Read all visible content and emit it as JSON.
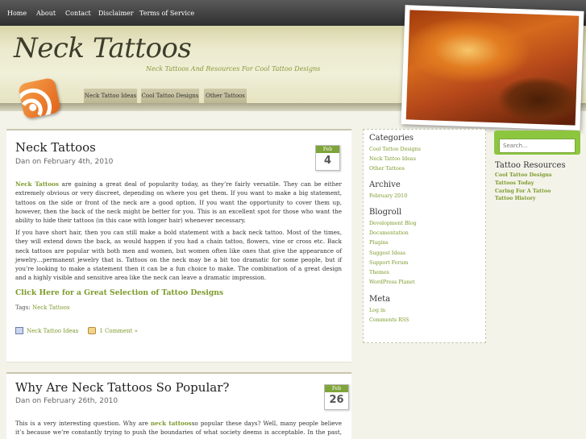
{
  "nav": [
    "Home",
    "About",
    "Contact",
    "Disclaimer",
    "Terms of Service"
  ],
  "site": {
    "title": "Neck Tattoos",
    "tagline": "Neck Tattoos And Resources For Cool Tattoo Designs"
  },
  "tabs": [
    "Neck Tattoo Ideas",
    "Cool Tattoo Designs",
    "Other Tattoos"
  ],
  "posts": [
    {
      "title": "Neck Tattoos",
      "meta": "Dan on February 4th, 2010",
      "month": "Feb",
      "day": "4",
      "p1_link": "Neck Tattoos",
      "p1_rest": " are gaining a great deal of popularity today, as they’re fairly versatile. They can be either extremely obvious or very discreet, depending on where you get them. If you want to make a big statement, tattoos on the side or front of the neck are a good option. If you want the opportunity to cover them up, however, then the back of the neck might be better for you. This is an excellent spot for those who want the ability to hide their tattoos (in this case with longer hair) whenever necessary.",
      "p2": "If you have short hair, then you can still make a bold statement with a back neck tattoo. Most of the times, they will extend down the back, as would happen if you had a chain tattoo, flowers, vine or cross etc. Back neck tattoos are popular with both men and women, but women often like ones that give the appearance of jewelry…permanent jewelry that is. Tattoos on the neck may be a bit too dramatic for some people, but if you’re looking to make a statement then it can be a fun choice to make. The combination of a great design and a highly visible and sensitive area like the neck can leave a dramatic impression.",
      "cta": "Click Here for a Great Selection of Tattoo Designs",
      "tags_label": "Tags:",
      "tags_value": "Neck Tattoos",
      "category": "Neck Tattoo Ideas",
      "comments": "1 Comment »"
    },
    {
      "title": "Why Are Neck Tattoos So Popular?",
      "meta": "Dan on February 26th, 2010",
      "month": "Feb",
      "day": "26",
      "p1_start": "This is a very interesting question. Why are ",
      "p1_link": "neck tattoos",
      "p1_rest": "so popular these days? Well, many people believe it’s because we’re constantly trying to push the boundaries of what society deems is acceptable. In the past, most people had tattoos on areas of their body that could easily be covered up."
    }
  ],
  "sidebar": {
    "categories_title": "Categories",
    "categories": [
      "Cool Tattoo Designs",
      "Neck Tattoo Ideas",
      "Other Tattoos"
    ],
    "archive_title": "Archive",
    "archive": [
      "February 2010"
    ],
    "blogroll_title": "Blogroll",
    "blogroll": [
      "Development Blog",
      "Documentation",
      "Plugins",
      "Suggest Ideas",
      "Support Forum",
      "Themes",
      "WordPress Planet"
    ],
    "meta_title": "Meta",
    "meta": [
      "Log in",
      "Comments RSS"
    ]
  },
  "search": {
    "placeholder": "Search..."
  },
  "resources": {
    "title": "Tattoo Resources",
    "links": [
      "Cool Tattoo Designs",
      "Tattoos Today",
      "Caring For A Tattoo",
      "Tattoo History"
    ]
  },
  "colors": {
    "accent": "#7c9a2a",
    "search_bg": "#8cc63f",
    "nav_bg": "#3a3a3a"
  }
}
